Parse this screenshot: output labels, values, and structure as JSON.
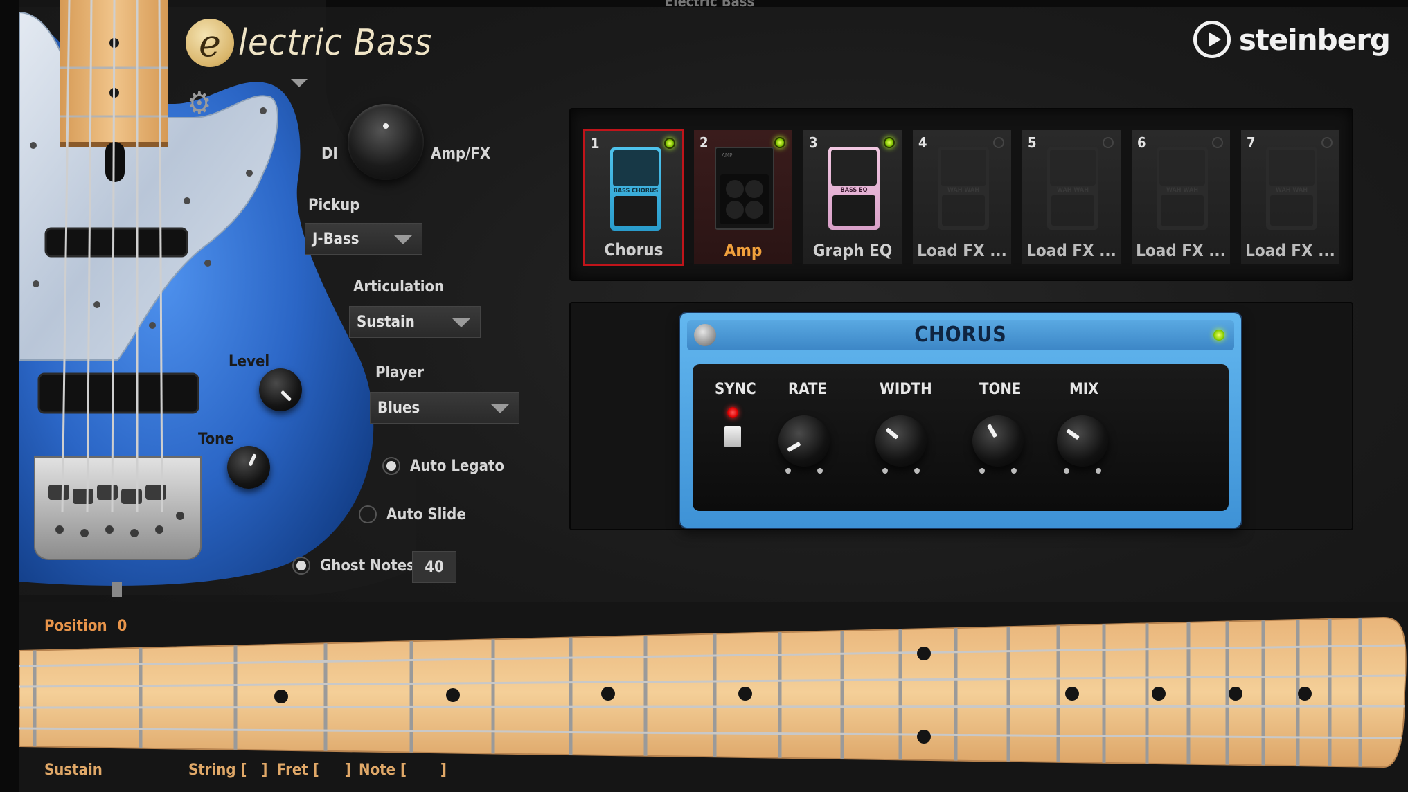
{
  "host_title": "Electric Bass",
  "logo": {
    "badge": "e",
    "text": "lectric Bass"
  },
  "brand": "steinberg",
  "controls": {
    "di_label": "DI",
    "ampfx_label": "Amp/FX",
    "pickup_label": "Pickup",
    "pickup_value": "J-Bass",
    "articulation_label": "Articulation",
    "articulation_value": "Sustain",
    "player_label": "Player",
    "player_value": "Blues",
    "level_label": "Level",
    "tone_label": "Tone",
    "auto_legato_label": "Auto Legato",
    "auto_slide_label": "Auto Slide",
    "ghost_notes_label": "Ghost Notes",
    "ghost_notes_value": "40"
  },
  "fx_slots": [
    {
      "num": "1",
      "name": "Chorus",
      "active": true,
      "selected": true
    },
    {
      "num": "2",
      "name": "Amp",
      "active": true,
      "selected": false
    },
    {
      "num": "3",
      "name": "Graph EQ",
      "active": true,
      "selected": false
    },
    {
      "num": "4",
      "name": "Load FX ...",
      "active": false,
      "selected": false
    },
    {
      "num": "5",
      "name": "Load FX ...",
      "active": false,
      "selected": false
    },
    {
      "num": "6",
      "name": "Load FX ...",
      "active": false,
      "selected": false
    },
    {
      "num": "7",
      "name": "Load FX ...",
      "active": false,
      "selected": false
    }
  ],
  "pedal_text": {
    "chorus": "BASS CHORUS",
    "eq": "BASS EQ",
    "ghost": "WAH WAH",
    "amp": "AMP"
  },
  "chorus": {
    "title": "CHORUS",
    "sync_label": "SYNC",
    "rate_label": "RATE",
    "width_label": "WIDTH",
    "tone_label": "TONE",
    "mix_label": "MIX"
  },
  "fretboard": {
    "position_label": "Position",
    "position_value": "0",
    "articulation": "Sustain",
    "string_label": "String [",
    "string_close": "]",
    "fret_label": "Fret [",
    "fret_close": "]",
    "note_label": "Note [",
    "note_close": "]"
  },
  "colors": {
    "accent_orange": "#e8944a",
    "led_green": "#b6ff2a",
    "led_red": "#ff2a2a",
    "body_blue": "#2f6fd0",
    "maple": "#f0c48a"
  }
}
